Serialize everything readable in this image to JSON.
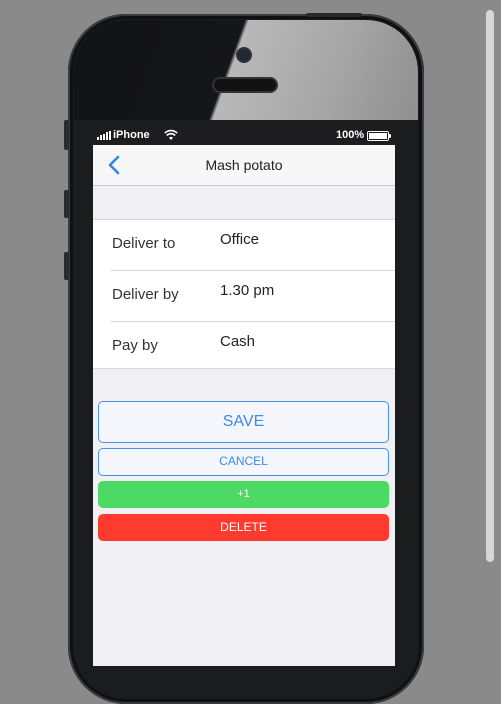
{
  "status_bar": {
    "carrier": "iPhone",
    "battery_percent": "100%",
    "signal_icon": "signal-bars-icon",
    "wifi_icon": "wifi-icon",
    "battery_icon": "battery-icon"
  },
  "nav": {
    "title": "Mash potato",
    "back_icon": "chevron-left-icon"
  },
  "form": {
    "rows": [
      {
        "label": "Deliver to",
        "value": "Office"
      },
      {
        "label": "Deliver by",
        "value": "1.30 pm"
      },
      {
        "label": "Pay by",
        "value": "Cash"
      }
    ]
  },
  "actions": {
    "save": "SAVE",
    "cancel": "CANCEL",
    "plus_one": "+1",
    "delete": "DELETE"
  },
  "colors": {
    "accent_blue": "#3d8ae8",
    "success_green": "#4cd964",
    "danger_red": "#ff3b30",
    "background": "#8a8a8a"
  }
}
